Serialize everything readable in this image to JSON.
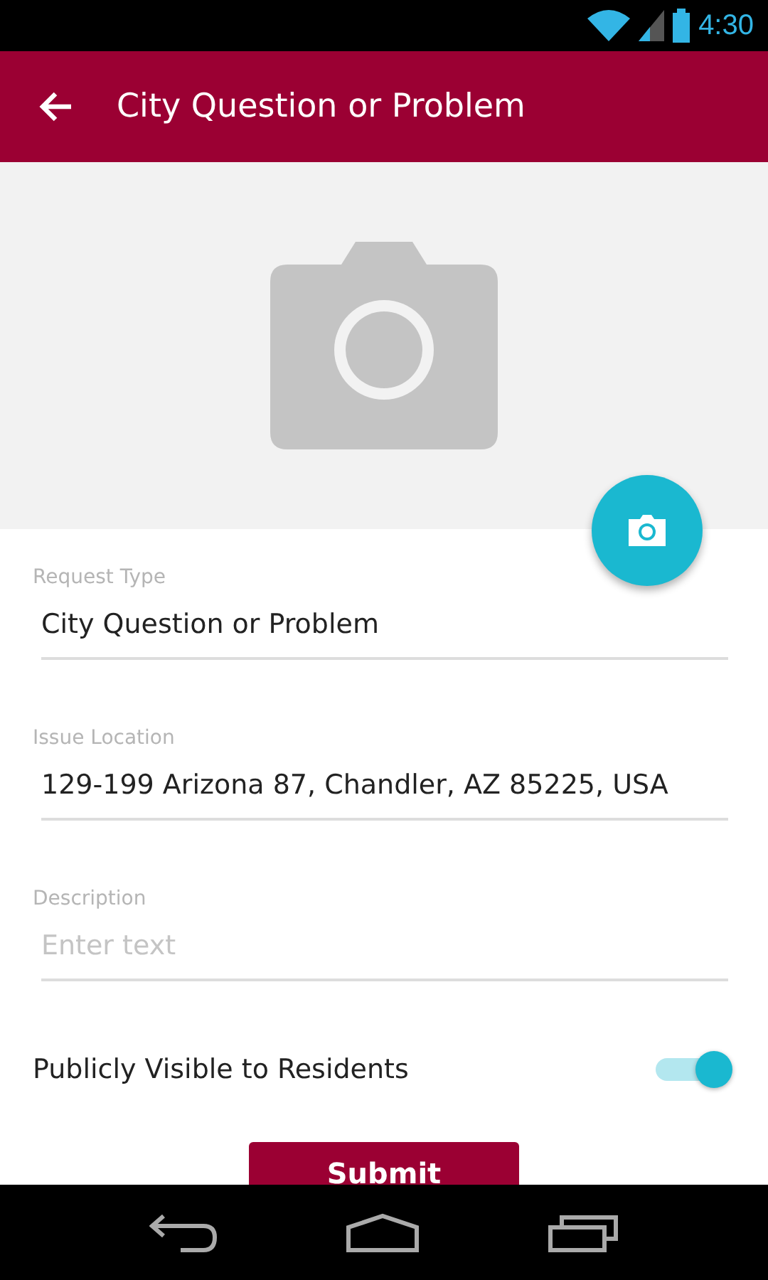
{
  "status_bar": {
    "time": "4:30"
  },
  "app_bar": {
    "title": "City Question or Problem"
  },
  "fields": [
    {
      "label": "Request Type",
      "value": "City Question or Problem"
    },
    {
      "label": "Issue Location",
      "value": "129-199 Arizona 87, Chandler, AZ 85225, USA"
    },
    {
      "label": "Description",
      "placeholder": "Enter text"
    }
  ],
  "visibility": {
    "label": "Publicly Visible to Residents",
    "on": true
  },
  "submit_button": {
    "label": "Submit"
  }
}
